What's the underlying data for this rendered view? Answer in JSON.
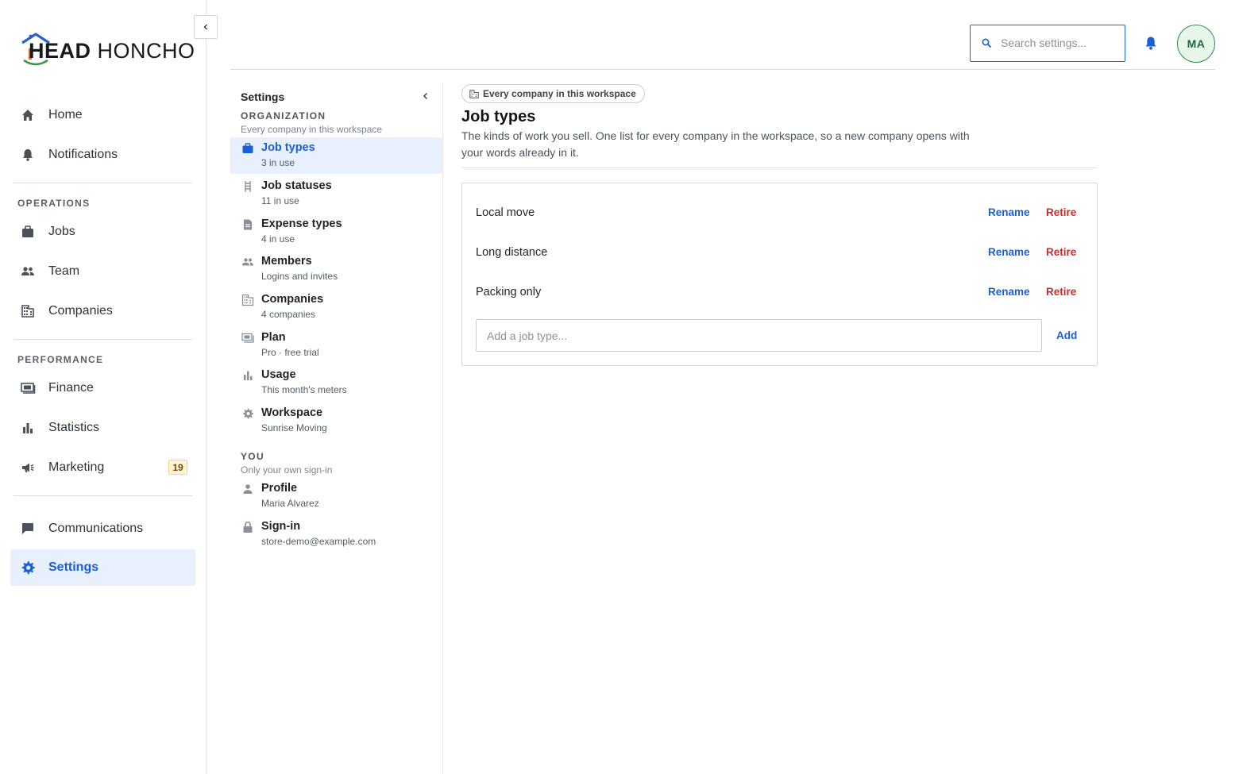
{
  "brand": {
    "logo_strong": "HEAD",
    "logo_light": " HONCHO"
  },
  "sidebar": {
    "top_items": [
      {
        "label": "Home",
        "icon": "home-icon"
      },
      {
        "label": "Notifications",
        "icon": "bell-icon"
      }
    ],
    "operations_title": "OPERATIONS",
    "operations_items": [
      {
        "label": "Jobs",
        "icon": "briefcase-icon"
      },
      {
        "label": "Team",
        "icon": "people-icon"
      },
      {
        "label": "Companies",
        "icon": "building-icon"
      }
    ],
    "performance_title": "PERFORMANCE",
    "performance_items": [
      {
        "label": "Finance",
        "icon": "money-icon"
      },
      {
        "label": "Statistics",
        "icon": "bar-chart-icon"
      },
      {
        "label": "Marketing",
        "icon": "megaphone-icon",
        "badge": "19"
      }
    ],
    "bottom_items": [
      {
        "label": "Communications",
        "icon": "chat-icon"
      },
      {
        "label": "Settings",
        "icon": "gear-icon",
        "active": true
      }
    ]
  },
  "topbar": {
    "search_placeholder": "Search settings...",
    "avatar_initials": "MA"
  },
  "subnav": {
    "title": "Settings",
    "org_section": {
      "title": "ORGANIZATION",
      "desc": "Every company in this workspace"
    },
    "org_items": [
      {
        "title": "Job types",
        "desc": "3 in use",
        "icon": "briefcase-icon",
        "active": true
      },
      {
        "title": "Job statuses",
        "desc": "11 in use",
        "icon": "ladder-icon"
      },
      {
        "title": "Expense types",
        "desc": "4 in use",
        "icon": "document-icon"
      },
      {
        "title": "Members",
        "desc": "Logins and invites",
        "icon": "people-icon"
      },
      {
        "title": "Companies",
        "desc": "4 companies",
        "icon": "building-icon"
      },
      {
        "title": "Plan",
        "desc": "Pro · free trial",
        "icon": "money-icon"
      },
      {
        "title": "Usage",
        "desc": "This month's meters",
        "icon": "bar-chart-icon"
      },
      {
        "title": "Workspace",
        "desc": "Sunrise Moving",
        "icon": "gear-icon"
      }
    ],
    "you_section": {
      "title": "YOU",
      "desc": "Only your own sign-in"
    },
    "you_items": [
      {
        "title": "Profile",
        "desc": "Maria Alvarez",
        "icon": "person-icon"
      },
      {
        "title": "Sign-in",
        "desc": "store-demo@example.com",
        "icon": "lock-icon"
      }
    ]
  },
  "main": {
    "scope_chip": "Every company in this workspace",
    "title": "Job types",
    "description": "The kinds of work you sell. One list for every company in the workspace, so a new company opens with your words already in it.",
    "job_types": [
      {
        "name": "Local move"
      },
      {
        "name": "Long distance"
      },
      {
        "name": "Packing only"
      }
    ],
    "rename_label": "Rename",
    "retire_label": "Retire",
    "add_placeholder": "Add a job type...",
    "add_label": "Add"
  },
  "colors": {
    "accent": "#1a5fd6",
    "danger": "#cf2a2a",
    "active_bg": "#e9f0fd",
    "avatar_green": "#2e8b4a",
    "logo_blue": "#2a63c8",
    "logo_orange": "#e0702a",
    "logo_green": "#3a9a4a"
  }
}
